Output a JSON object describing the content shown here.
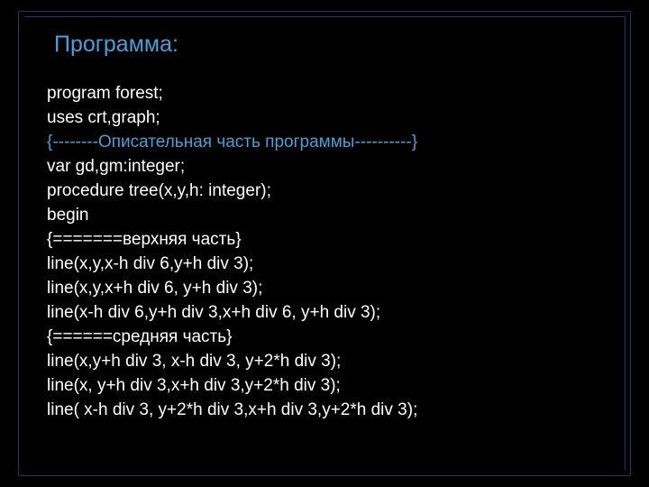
{
  "title": "Программа:",
  "code": {
    "l1": "program forest;",
    "l2": "uses crt,graph;",
    "l3": "{--------Описательная часть программы----------}",
    "l4": "var gd,gm:integer;",
    "l5": "procedure tree(x,y,h: integer);",
    "l6": "begin",
    "l7": "{=======верхняя часть}",
    "l8": "line(x,y,x-h div 6,y+h div 3);",
    "l9": "line(x,y,x+h div 6, y+h div 3);",
    "l10": "line(x-h div 6,y+h div 3,x+h div 6, y+h div 3);",
    "l11": "{======средняя часть}",
    "l12": "line(x,y+h div 3, x-h div 3, y+2*h div 3);",
    "l13": "line(x, y+h div 3,x+h div 3,y+2*h div 3);",
    "l14": "line( x-h div 3, y+2*h div 3,x+h div 3,y+2*h div 3);"
  }
}
